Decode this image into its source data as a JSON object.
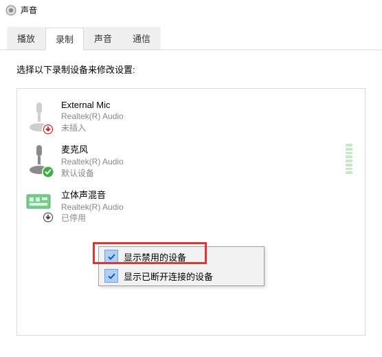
{
  "window": {
    "title": "声音"
  },
  "tabs": [
    {
      "label": "播放",
      "active": false
    },
    {
      "label": "录制",
      "active": true
    },
    {
      "label": "声音",
      "active": false
    },
    {
      "label": "通信",
      "active": false
    }
  ],
  "instruction": "选择以下录制设备来修改设置:",
  "devices": [
    {
      "name": "External Mic",
      "provider": "Realtek(R) Audio",
      "status": "未插入",
      "badge": "unplugged",
      "meter": false
    },
    {
      "name": "麦克风",
      "provider": "Realtek(R) Audio",
      "status": "默认设备",
      "badge": "default",
      "meter": true
    },
    {
      "name": "立体声混音",
      "provider": "Realtek(R) Audio",
      "status": "已停用",
      "badge": "disabled",
      "meter": false
    }
  ],
  "context_menu": {
    "items": [
      {
        "label": "显示禁用的设备",
        "checked": true
      },
      {
        "label": "显示已断开连接的设备",
        "checked": true
      }
    ]
  }
}
